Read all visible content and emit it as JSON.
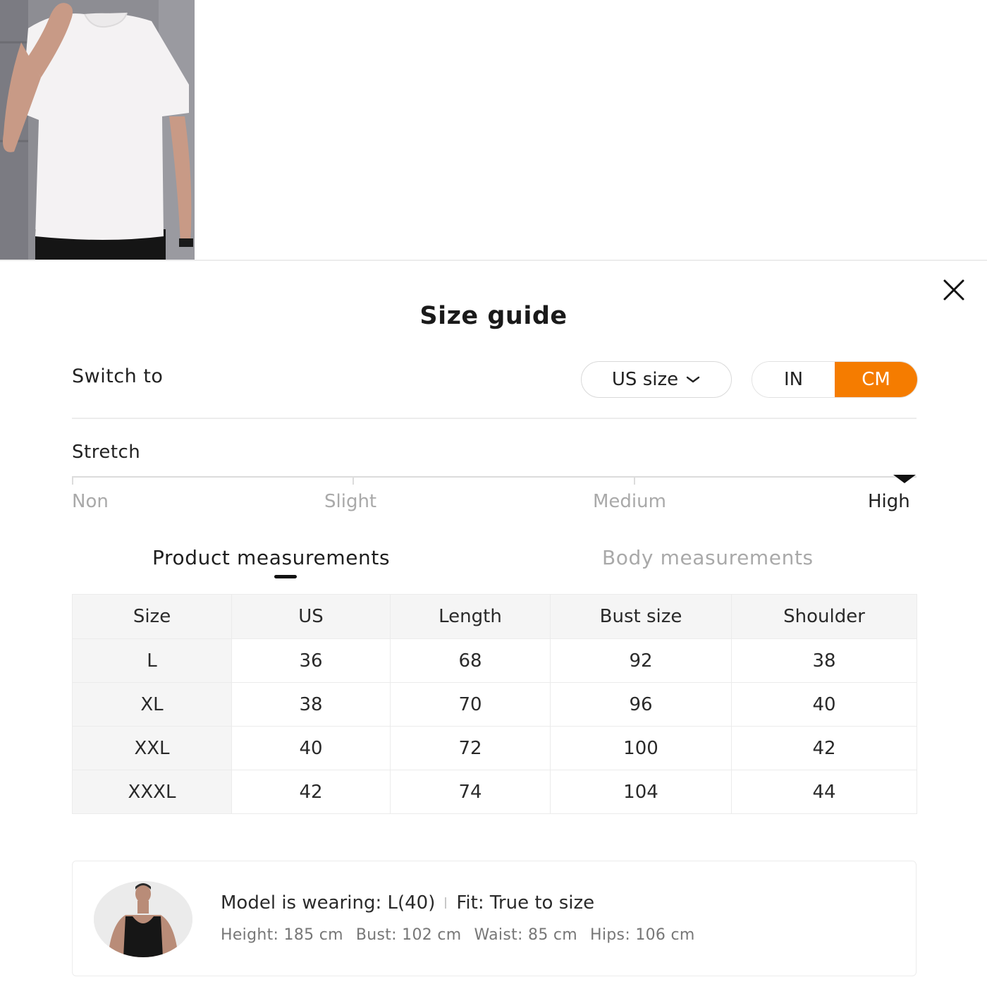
{
  "sheet": {
    "title": "Size guide",
    "switch_label": "Switch to",
    "size_system": "US size",
    "units": [
      "IN",
      "CM"
    ],
    "active_unit": "CM",
    "accent_color": "#f57c00"
  },
  "stretch": {
    "label": "Stretch",
    "levels": [
      "Non",
      "Slight",
      "Medium",
      "High"
    ],
    "selected": "High"
  },
  "tabs": {
    "product": "Product measurements",
    "body": "Body measurements",
    "active": "Product measurements"
  },
  "table": {
    "headers": [
      "Size",
      "US",
      "Length",
      "Bust size",
      "Shoulder"
    ],
    "rows": [
      [
        "L",
        "36",
        "68",
        "92",
        "38"
      ],
      [
        "XL",
        "38",
        "70",
        "96",
        "40"
      ],
      [
        "XXL",
        "40",
        "72",
        "100",
        "42"
      ],
      [
        "XXXL",
        "42",
        "74",
        "104",
        "44"
      ]
    ]
  },
  "model": {
    "wearing": "Model is wearing: L(40)",
    "fit": "Fit: True to size",
    "height": "Height: 185 cm",
    "bust": "Bust: 102 cm",
    "waist": "Waist: 85 cm",
    "hips": "Hips: 106 cm"
  },
  "icons": {
    "close": "close-icon",
    "dropdown": "chevron-down-icon"
  }
}
